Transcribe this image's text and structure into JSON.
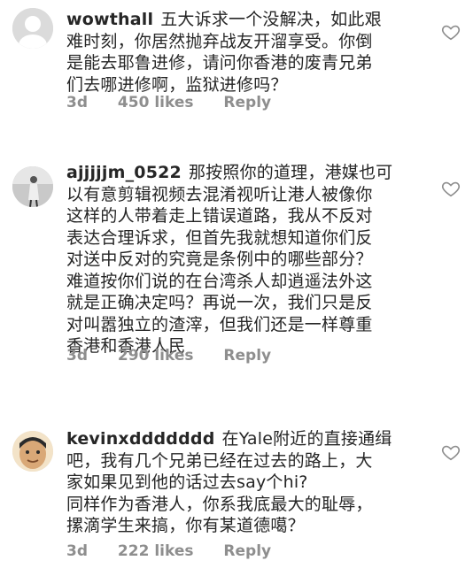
{
  "comments": [
    {
      "username": "wowthall",
      "text": "五大诉求一个没解决，如此艰\n难时刻，你居然抛弃战友开溜享受。你倒\n是能去耶鲁进修，请问你香港的废青兄弟\n们去哪进修啊，监狱进修吗？",
      "time": "3d",
      "likes": "450 likes",
      "reply": "Reply",
      "avatar": "default-avatar"
    },
    {
      "username": "ajjjjjm_0522",
      "text": "那按照你的道理，港媒也可\n以有意剪辑视频去混淆视听让港人被像你\n这样的人带着走上错误道路，我从不反对\n表达合理诉求，但首先我就想知道你们反\n对送中反对的究竟是条例中的哪些部分？\n难道按你们说的在台湾杀人却逍遥法外这\n就是正确决定吗？再说一次，我们只是反\n对叫嚣独立的渣滓，但我们还是一样尊重\n香港和香港人民",
      "time": "3d",
      "likes": "290 likes",
      "reply": "Reply",
      "avatar": "photo-avatar"
    },
    {
      "username": "kevinxddddddd",
      "text": "在Yale附近的直接通缉\n吧，我有几个兄弟已经在过去的路上，大\n家如果见到他的话过去say个hi?\n同样作为香港人，你系我底最大的耻辱，\n摞滴学生来搞，你有某道德噶？",
      "time": "3d",
      "likes": "222 likes",
      "reply": "Reply",
      "avatar": "photo-avatar"
    }
  ]
}
